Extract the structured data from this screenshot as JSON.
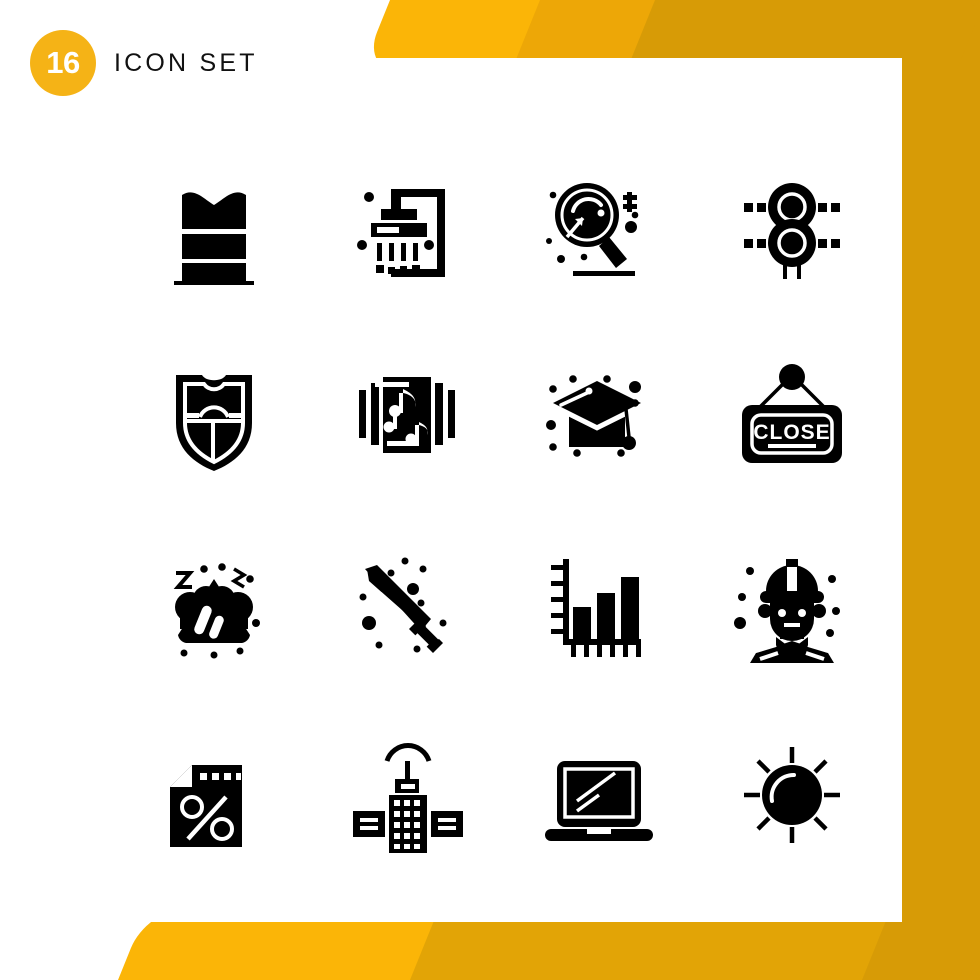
{
  "header": {
    "count": "16",
    "title": "Icon Set",
    "badge_color": "#F5B316",
    "title_color": "#111111"
  },
  "decoration": {
    "accent_light": "#FBB507",
    "accent_mid": "#EDA707",
    "accent_dark": "#D79B06",
    "page_background": "#FFFFFF"
  },
  "icons": [
    {
      "index": 1,
      "name": "towel-stack-icon",
      "label": "Towel Stack",
      "row": 1,
      "col": 1
    },
    {
      "index": 2,
      "name": "shower-icon",
      "label": "Shower",
      "row": 1,
      "col": 2
    },
    {
      "index": 3,
      "name": "magnifier-search-icon",
      "label": "Search",
      "row": 1,
      "col": 3
    },
    {
      "index": 4,
      "name": "traffic-signal-icon",
      "label": "Traffic Signal",
      "row": 1,
      "col": 4
    },
    {
      "index": 5,
      "name": "shield-crest-icon",
      "label": "Shield",
      "row": 2,
      "col": 1
    },
    {
      "index": 6,
      "name": "music-sheet-icon",
      "label": "Music Sheet",
      "row": 2,
      "col": 2
    },
    {
      "index": 7,
      "name": "graduation-cap-icon",
      "label": "Graduation Cap",
      "row": 2,
      "col": 3
    },
    {
      "index": 8,
      "name": "close-sign-icon",
      "label": "Close Sign",
      "row": 2,
      "col": 4,
      "text": "CLOSE"
    },
    {
      "index": 9,
      "name": "sleeping-mountain-icon",
      "label": "Sleep",
      "row": 3,
      "col": 1
    },
    {
      "index": 10,
      "name": "hand-saw-icon",
      "label": "Hand Saw",
      "row": 3,
      "col": 2
    },
    {
      "index": 11,
      "name": "bar-chart-icon",
      "label": "Bar Chart",
      "row": 3,
      "col": 3
    },
    {
      "index": 12,
      "name": "construction-worker-icon",
      "label": "Construction Worker",
      "row": 3,
      "col": 4
    },
    {
      "index": 13,
      "name": "discount-document-icon",
      "label": "Discount Document",
      "row": 4,
      "col": 1
    },
    {
      "index": 14,
      "name": "satellite-icon",
      "label": "Satellite",
      "row": 4,
      "col": 2
    },
    {
      "index": 15,
      "name": "laptop-icon",
      "label": "Laptop",
      "row": 4,
      "col": 3
    },
    {
      "index": 16,
      "name": "sun-icon",
      "label": "Sun",
      "row": 4,
      "col": 4
    }
  ],
  "chart_icon_data": {
    "type": "bar",
    "bars": [
      38,
      58,
      78
    ],
    "axis_ticks_y": 5,
    "axis_ticks_x": 6
  }
}
